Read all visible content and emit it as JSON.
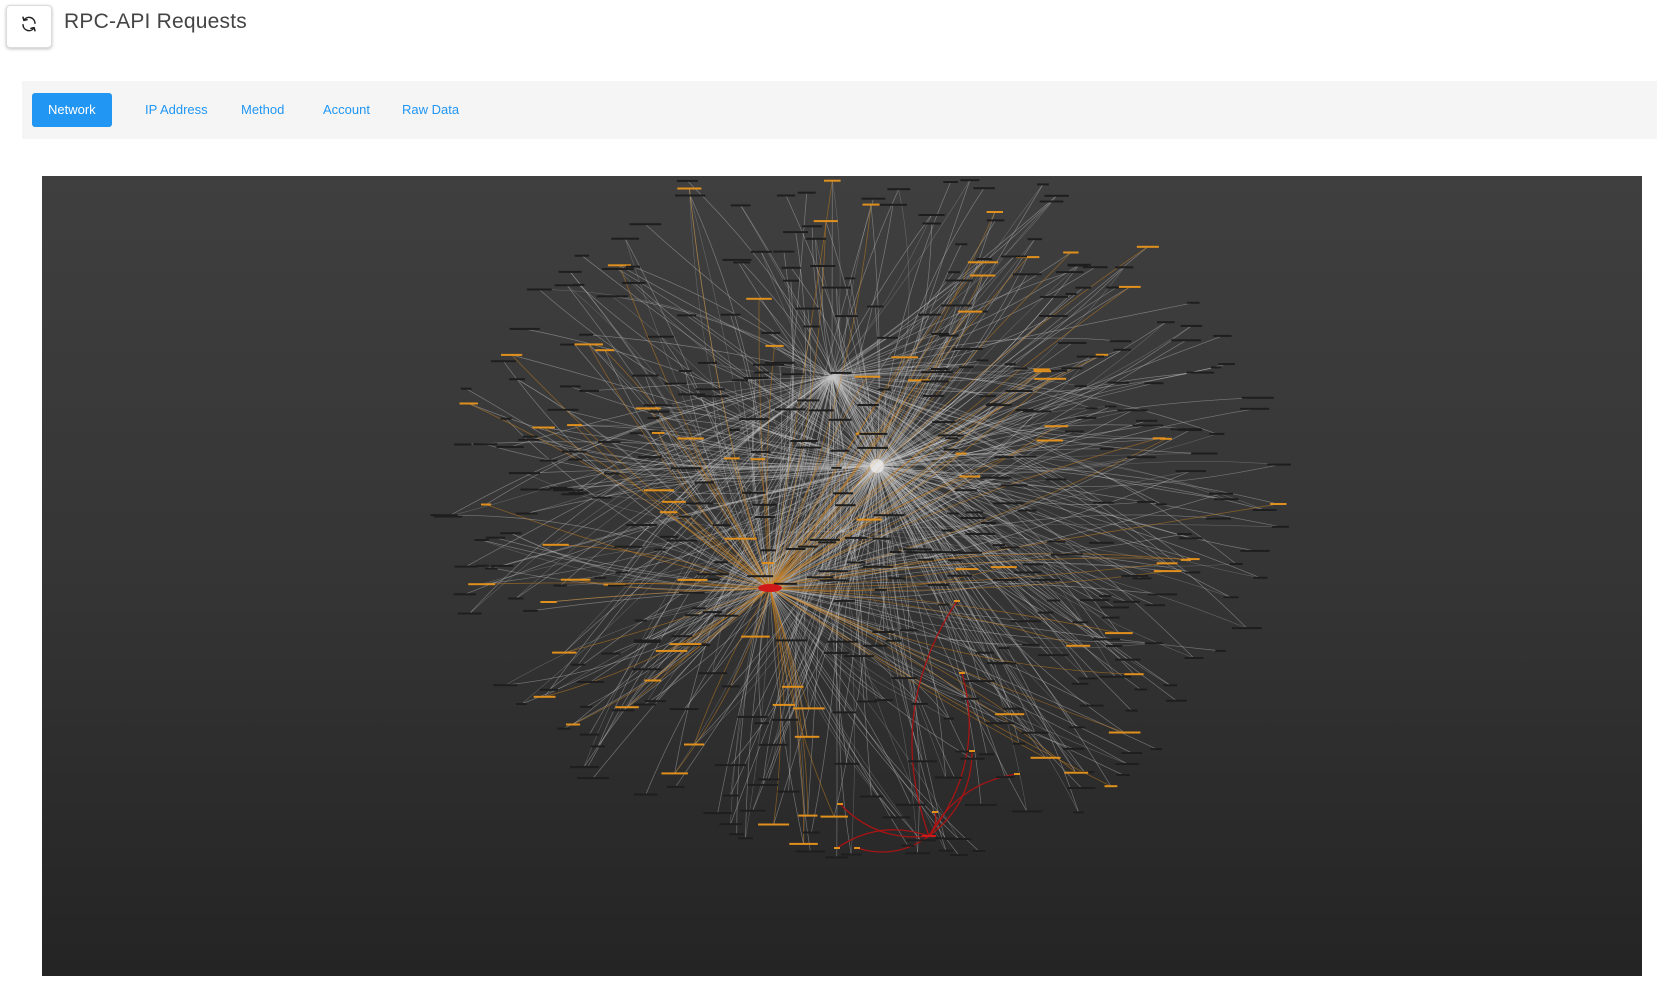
{
  "header": {
    "title": "RPC-API Requests",
    "refresh_icon": "refresh-icon"
  },
  "tabs": [
    {
      "label": "Network",
      "active": true
    },
    {
      "label": "IP Address",
      "active": false
    },
    {
      "label": "Method",
      "active": false
    },
    {
      "label": "Account",
      "active": false
    },
    {
      "label": "Raw Data",
      "active": false
    }
  ],
  "graph": {
    "background_top": "#3f3f3f",
    "background_bottom": "#242424",
    "edge_color_default": "#c8c8c8",
    "edge_color_highlight": "#c8801f",
    "edge_color_alert": "#b31212",
    "node_color_default": "#1e1e1e",
    "node_color_highlight": "#e0901c",
    "node_color_alert": "#d01a1a"
  },
  "colors": {
    "accent": "#2196f3",
    "title": "#444444",
    "tabbar_bg": "#f5f5f5"
  }
}
